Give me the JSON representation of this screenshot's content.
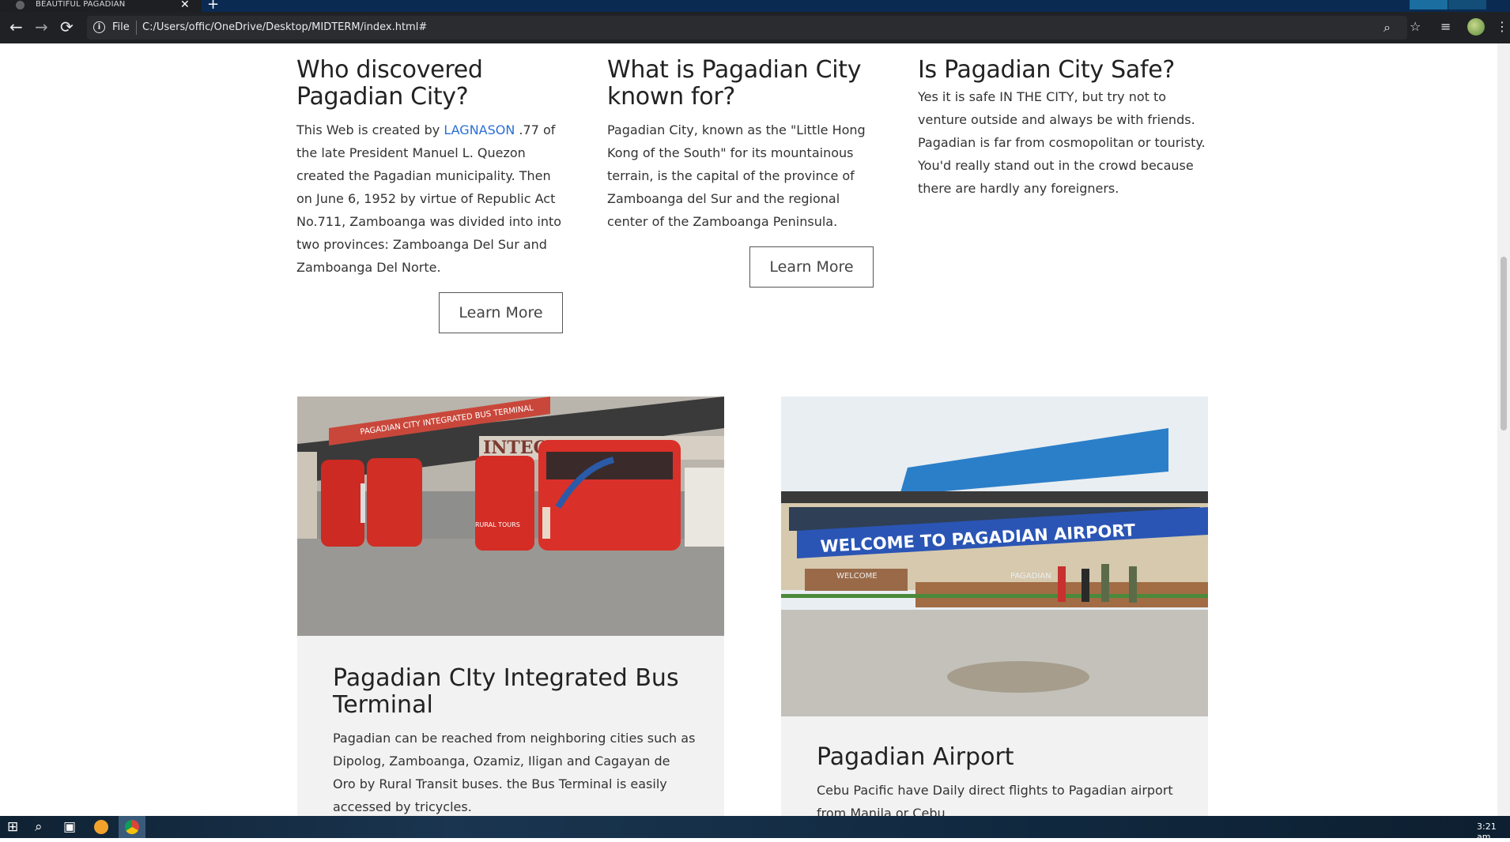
{
  "browser": {
    "tab_title": "BEAUTIFUL PAGADIAN",
    "tab_close": "✕",
    "new_tab": "+",
    "scheme_label": "File",
    "url": "C:/Users/offic/OneDrive/Desktop/MIDTERM/index.html#",
    "icons": [
      "back-icon",
      "forward-icon",
      "reload-icon",
      "info-icon",
      "zoom-icon",
      "star-icon",
      "reading-list-icon",
      "profile-avatar",
      "menu-icon"
    ]
  },
  "sections": [
    {
      "title": "Who discovered Pagadian City?",
      "body_prefix": "This Web is created by ",
      "body_link": "LAGNASON",
      "body_suffix": " .77 of the late President Manuel L. Quezon created the Pagadian municipality. Then on June 6, 1952 by virtue of Republic Act No.711, Zamboanga was divided into into two provinces: Zamboanga Del Sur and Zamboanga Del Norte.",
      "button": "Learn More"
    },
    {
      "title": "What is Pagadian City known for?",
      "body": "Pagadian City, known as the \"Little Hong Kong of the South\" for its mountainous terrain, is the capital of the province of Zamboanga del Sur and the regional center of the Zamboanga Peninsula.",
      "button": "Learn More"
    },
    {
      "title": "Is Pagadian City Safe?",
      "body": "Yes it is safe IN THE CITY, but try not to venture outside and always be with friends. Pagadian is far from cosmopolitan or touristy. You'd really stand out in the crowd because there are hardly any foreigners."
    }
  ],
  "cards": [
    {
      "image_signs": [
        "PAGADIAN CITY INTEGRATED BUS TERMINAL",
        "INTEGRATED BUS",
        "RURAL TOURS"
      ],
      "title": "Pagadian CIty Integrated Bus Terminal",
      "body": "Pagadian can be reached from neighboring cities such as Dipolog, Zamboanga, Ozamiz, Iligan and Cagayan de Oro by Rural Transit buses. the Bus Terminal is easily accessed by tricycles."
    },
    {
      "image_signs": [
        "WELCOME TO PAGADIAN AIRPORT",
        "WELCOME",
        "PAGADIAN"
      ],
      "title": "Pagadian Airport",
      "body": "Cebu Pacific have Daily direct flights to Pagadian airport from Manila or Cebu."
    }
  ],
  "taskbar": {
    "clock": "3:21 am",
    "icons": [
      "start-icon",
      "search-icon",
      "task-view-icon",
      "app-icon",
      "chrome-icon"
    ]
  }
}
